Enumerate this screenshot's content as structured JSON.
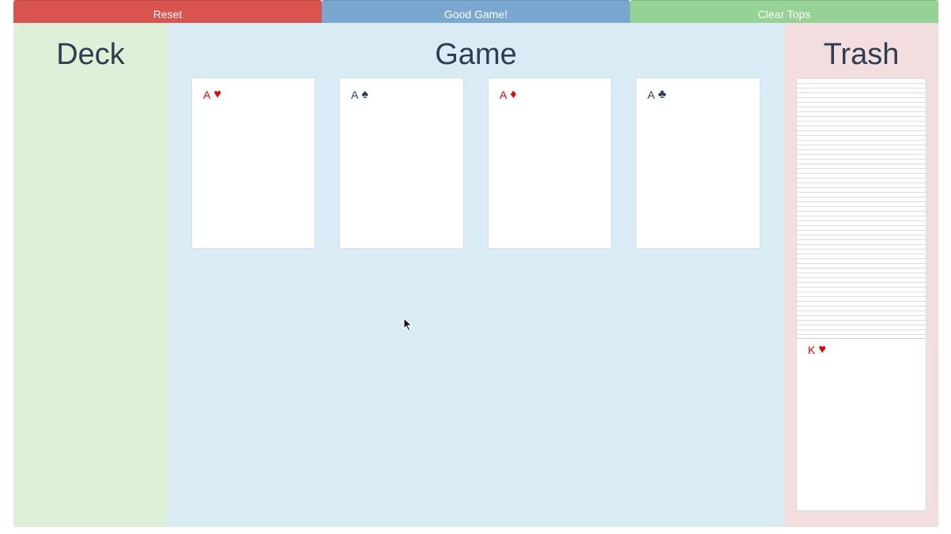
{
  "toolbar": {
    "reset_label": "Reset",
    "good_game_label": "Good Game!",
    "clear_tops_label": "Clear Tops"
  },
  "deck": {
    "title": "Deck"
  },
  "game": {
    "title": "Game",
    "cards": [
      {
        "rank": "A",
        "suit": "♥",
        "color": "red"
      },
      {
        "rank": "A",
        "suit": "♠",
        "color": "dark"
      },
      {
        "rank": "A",
        "suit": "♦",
        "color": "red"
      },
      {
        "rank": "A",
        "suit": "♣",
        "color": "dark"
      }
    ]
  },
  "trash": {
    "title": "Trash",
    "top_card": {
      "rank": "K",
      "suit": "♥",
      "color": "red"
    }
  },
  "colors": {
    "reset": "#d9534f",
    "good_game": "#7aa7cf",
    "clear_tops": "#96d295",
    "deck_bg": "#dff0d8",
    "game_bg": "#d9ecf5",
    "trash_bg": "#f2dedf",
    "red_suit": "#e8000b",
    "dark_suit": "#2c3e50"
  }
}
